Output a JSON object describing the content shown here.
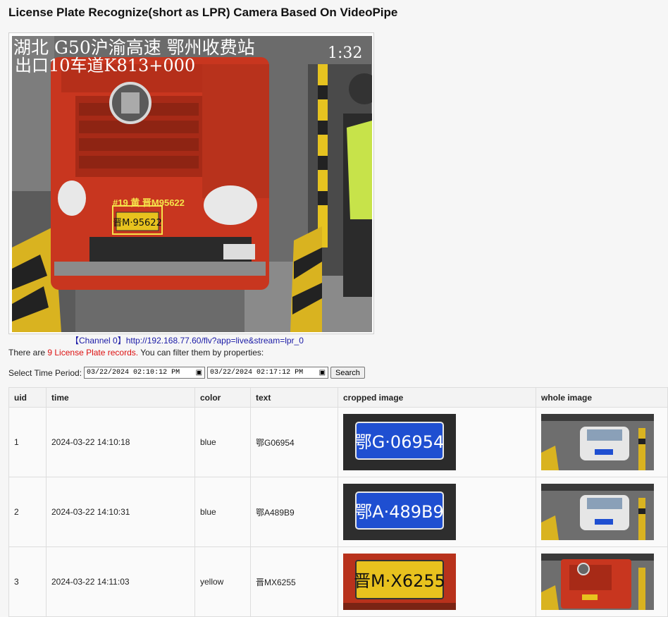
{
  "page": {
    "title": "License Plate Recognize(short as LPR) Camera Based On VideoPipe"
  },
  "video": {
    "osd_line1": "湖北    G50沪渝高速    鄂州收费站",
    "osd_time": "1:32",
    "osd_line2": "出口10车道K813+000",
    "detection_label": "#19 黄 晋M95622",
    "plate_text": "晋M·95622"
  },
  "channel": {
    "label": "【Channel 0】",
    "url": "http://192.168.77.60/flv?app=live&stream=lpr_0"
  },
  "records_info": {
    "prefix": "There are",
    "count_text": "9 License Plate records.",
    "suffix": "You can filter them by properties:"
  },
  "filter": {
    "label": "Select Time Period:",
    "start": "03/22/2024  02:10:12  PM",
    "end": "03/22/2024  02:17:12  PM",
    "search_label": "Search"
  },
  "table": {
    "headers": [
      "uid",
      "time",
      "color",
      "text",
      "cropped image",
      "whole image"
    ],
    "rows": [
      {
        "uid": "1",
        "time": "2024-03-22 14:10:18",
        "color": "blue",
        "text": "鄂G06954",
        "crop_text": "鄂G·06954"
      },
      {
        "uid": "2",
        "time": "2024-03-22 14:10:31",
        "color": "blue",
        "text": "鄂A489B9",
        "crop_text": "鄂A·489B9"
      },
      {
        "uid": "3",
        "time": "2024-03-22 14:11:03",
        "color": "yellow",
        "text": "晋MX6255",
        "crop_text": "晋M·X6255"
      }
    ]
  },
  "colors": {
    "plate_blue": "#1f4fd1",
    "plate_yellow": "#e8c21e",
    "truck_red": "#c8361f",
    "detection_box": "#f5e34a",
    "record_count": "#dd1111",
    "link": "#1a1aa6"
  }
}
